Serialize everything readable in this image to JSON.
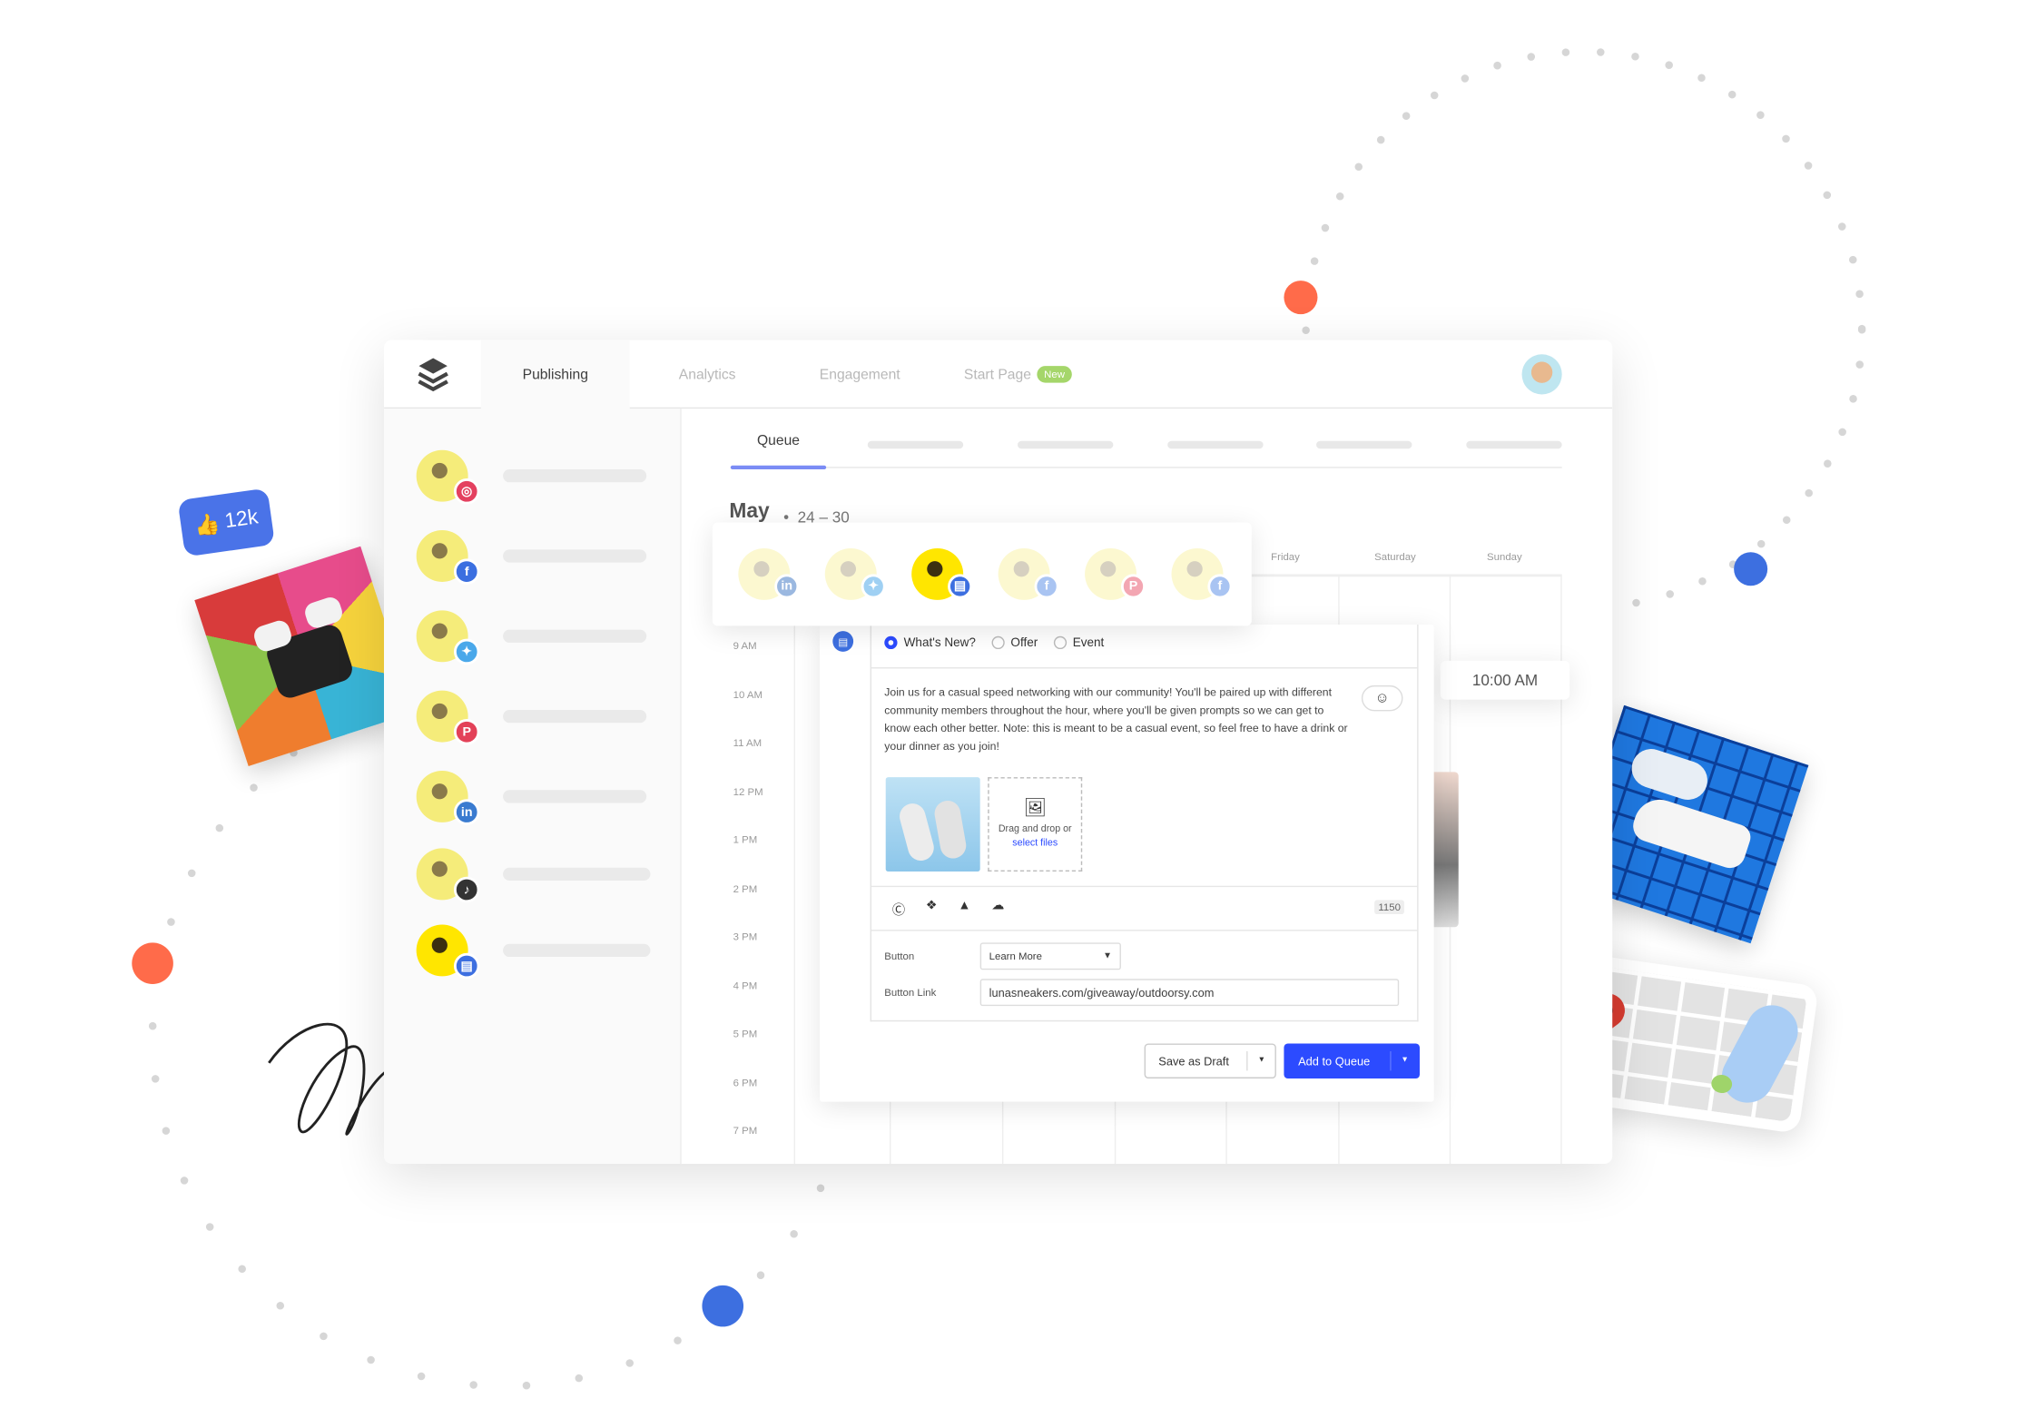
{
  "colors": {
    "accent": "#2c4bff",
    "new_badge": "#a5d66a",
    "coral": "#ff6b4a",
    "blue_dot": "#3d6fe0",
    "tab_underline": "#7b8cf5"
  },
  "social_badge": {
    "count": "12k",
    "icon": "thumbs-up-icon"
  },
  "header": {
    "nav": [
      {
        "label": "Publishing",
        "active": true
      },
      {
        "label": "Analytics"
      },
      {
        "label": "Engagement"
      },
      {
        "label": "Start Page",
        "badge": "New"
      }
    ],
    "logo_icon": "stack-layers-icon",
    "avatar": "user-avatar"
  },
  "sidebar": {
    "channels": [
      {
        "network": "instagram",
        "icon": "instagram-icon",
        "color": "#e4405f"
      },
      {
        "network": "facebook",
        "icon": "facebook-icon",
        "color": "#3b6fe0"
      },
      {
        "network": "twitter",
        "icon": "twitter-icon",
        "color": "#4aa8ea"
      },
      {
        "network": "pinterest",
        "icon": "pinterest-icon",
        "color": "#e34158"
      },
      {
        "network": "linkedin",
        "icon": "linkedin-icon",
        "color": "#3a7bd0"
      },
      {
        "network": "tiktok",
        "icon": "tiktok-icon",
        "color": "#333333"
      },
      {
        "network": "google-business",
        "icon": "google-business-icon",
        "color": "#3d6fe0"
      }
    ]
  },
  "main": {
    "tabs": [
      {
        "label": "Queue",
        "active": true
      }
    ],
    "month": "May",
    "range": "24 – 30",
    "days": [
      "Friday",
      "Saturday",
      "Sunday"
    ],
    "times": [
      "9 AM",
      "10 AM",
      "11 AM",
      "12 PM",
      "1 PM",
      "2 PM",
      "3 PM",
      "4 PM",
      "5 PM",
      "6 PM",
      "7 PM"
    ],
    "time_tooltip": "10:00 AM"
  },
  "profile_picker": [
    {
      "network": "linkedin",
      "icon": "linkedin-icon",
      "color": "#9bb8e0",
      "selected": false
    },
    {
      "network": "twitter",
      "icon": "twitter-icon",
      "color": "#9fd0f3",
      "selected": false
    },
    {
      "network": "google-business",
      "icon": "google-business-icon",
      "color": "#3d6fe0",
      "selected": true
    },
    {
      "network": "facebook",
      "icon": "facebook-icon",
      "color": "#a9c4f2",
      "selected": false
    },
    {
      "network": "pinterest",
      "icon": "pinterest-icon",
      "color": "#f3a6b2",
      "selected": false
    },
    {
      "network": "facebook",
      "icon": "facebook-icon",
      "color": "#a9c4f2",
      "selected": false
    }
  ],
  "composer": {
    "post_types": [
      {
        "label": "What's New?",
        "selected": true
      },
      {
        "label": "Offer",
        "selected": false
      },
      {
        "label": "Event",
        "selected": false
      }
    ],
    "text": "Join us for a casual speed networking with our community! You'll be paired up with different community members throughout the hour, where you'll be given prompts so we can get to know each other better. Note: this is meant to be a casual event, so feel free to have a drink or your dinner as you join!",
    "dropzone": {
      "text": "Drag and drop or",
      "link": "select files"
    },
    "toolbar_icons": [
      "canva-icon",
      "dropbox-icon",
      "google-drive-icon",
      "cloud-icon"
    ],
    "char_count": "1150",
    "button_label": "Button",
    "button_value": "Learn More",
    "link_label": "Button Link",
    "link_value": "lunasneakers.com/giveaway/outdoorsy.com",
    "save_draft": "Save as Draft",
    "add_queue": "Add to Queue"
  }
}
